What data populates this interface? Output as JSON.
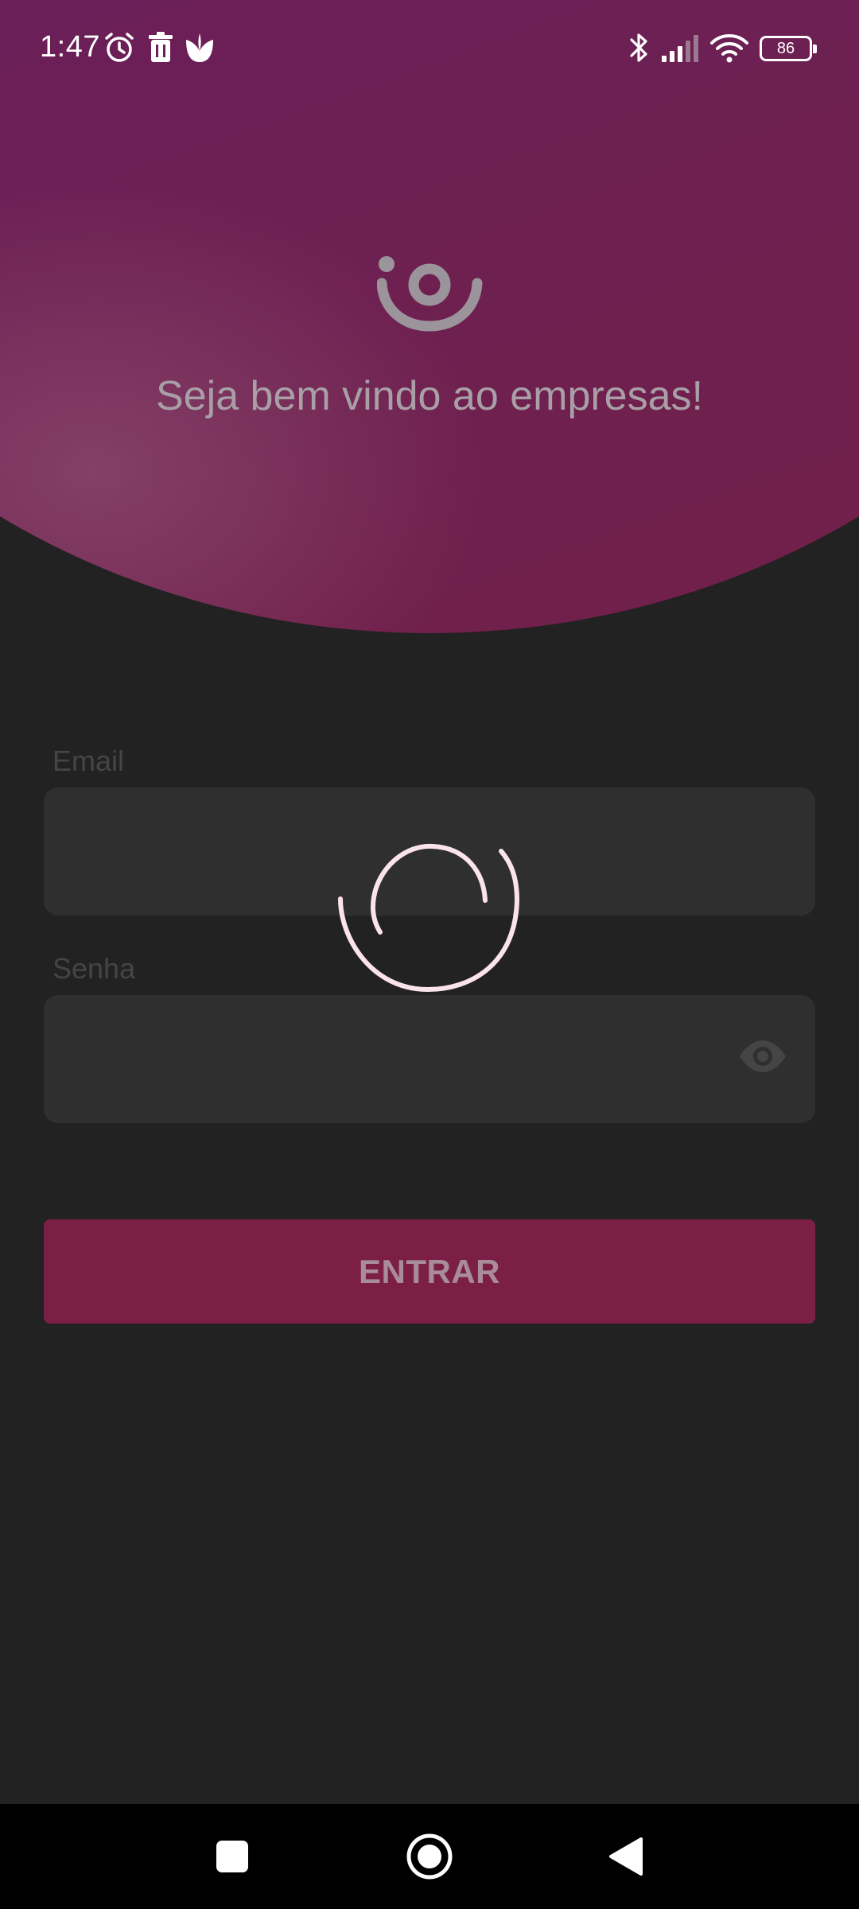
{
  "status_bar": {
    "time": "1:47",
    "battery": "86",
    "icons": [
      "alarm-icon",
      "trash-icon",
      "leaf-icon",
      "bluetooth-icon",
      "signal-icon",
      "wifi-icon",
      "battery-icon"
    ]
  },
  "header": {
    "welcome": "Seja bem vindo ao empresas!",
    "logo": "app-logo"
  },
  "form": {
    "email_label": "Email",
    "email_value": "",
    "password_label": "Senha",
    "password_value": "",
    "submit_label": "ENTRAR"
  },
  "loading": {
    "visible": true,
    "icon": "loading-spinner"
  },
  "nav": {
    "buttons": [
      "recents-button",
      "home-button",
      "back-button"
    ]
  },
  "colors": {
    "header_gradient_start": "#6a1f5a",
    "header_gradient_end": "#722046",
    "background": "#222222",
    "field_background": "#2f2f2f",
    "button": "#7b1f46",
    "spinner": "#fbe3ee"
  }
}
